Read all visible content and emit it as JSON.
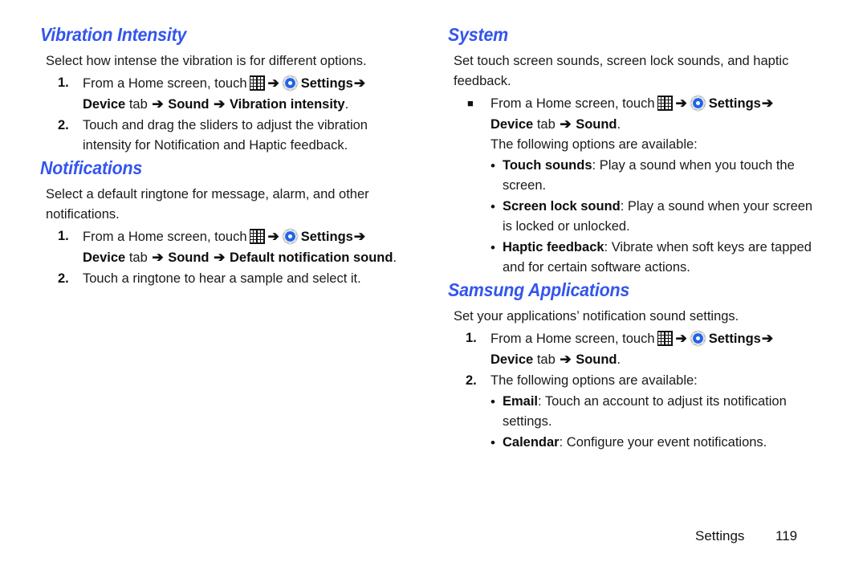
{
  "page": {
    "footer_label": "Settings",
    "footer_page_number": "119",
    "heading_color": "#3355EE",
    "text_color": "#1a1a1a"
  },
  "icons": {
    "apps_grid": "apps-grid-icon",
    "settings_gear": "settings-gear-icon",
    "arrow": "➔"
  },
  "left_column": {
    "section1": {
      "heading": "Vibration Intensity",
      "intro": "Select how intense the vibration is for different options.",
      "steps": [
        {
          "number": "1.",
          "line1_a": "From a Home screen, touch",
          "line1_b": "Settings",
          "line2_a": "Device",
          "line2_b": "tab",
          "line2_c": "Sound",
          "line2_d": "Vibration intensity",
          "line2_end": "."
        },
        {
          "number": "2.",
          "text": "Touch and drag the sliders to adjust the vibration intensity for Notification and Haptic feedback."
        }
      ]
    },
    "section2": {
      "heading": "Notifications",
      "intro": "Select a default ringtone for message, alarm, and other notifications.",
      "steps": [
        {
          "number": "1.",
          "line1_a": "From a Home screen, touch",
          "line1_b": "Settings",
          "line2_a": "Device",
          "line2_b": "tab",
          "line2_c": "Sound",
          "line2_d": "Default notification sound",
          "line2_end": "."
        },
        {
          "number": "2.",
          "text": "Touch a ringtone to hear a sample and select it."
        }
      ]
    }
  },
  "right_column": {
    "section1": {
      "heading": "System",
      "intro": "Set touch screen sounds, screen lock sounds, and haptic feedback.",
      "step": {
        "marker": "■",
        "line1_a": "From a Home screen, touch",
        "line1_b": "Settings",
        "line2_a": "Device",
        "line2_b": "tab",
        "line2_c": "Sound",
        "line2_end": "."
      },
      "options_intro": "The following options are available:",
      "options": [
        {
          "term": "Touch sounds",
          "desc": ": Play a sound when you touch the screen."
        },
        {
          "term": "Screen lock sound",
          "desc": ": Play a sound when your screen is locked or unlocked."
        },
        {
          "term": "Haptic feedback",
          "desc": ": Vibrate when soft keys are tapped and for certain software actions."
        }
      ]
    },
    "section2": {
      "heading": "Samsung Applications",
      "intro": "Set your applications’ notification sound settings.",
      "step1": {
        "number": "1.",
        "line1_a": "From a Home screen, touch",
        "line1_b": "Settings",
        "line2_a": "Device",
        "line2_b": "tab",
        "line2_c": "Sound",
        "line2_end": "."
      },
      "step2": {
        "number": "2.",
        "text": "The following options are available:"
      },
      "options": [
        {
          "term": "Email",
          "desc": ": Touch an account to adjust its notification settings."
        },
        {
          "term": "Calendar",
          "desc": ": Configure your event notifications."
        }
      ]
    }
  }
}
